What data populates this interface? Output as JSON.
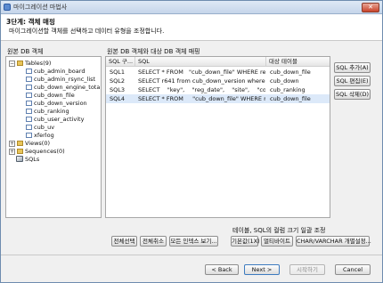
{
  "window": {
    "title": "마이그레이션 마법사",
    "close_glyph": "✕"
  },
  "header": {
    "step_title": "3단계: 객체 매핑",
    "step_desc": "마이그레이션할 객체를 선택하고 데이터 유형을 조정합니다."
  },
  "source": {
    "label": "원본 DB 객체",
    "tree": [
      {
        "label": "Tables(9)",
        "icon": "folder-icon",
        "expander": "−"
      },
      {
        "label": "cub_admin_board",
        "icon": "table-icon"
      },
      {
        "label": "cub_admin_rsync_list",
        "icon": "table-icon"
      },
      {
        "label": "cub_down_engine_total",
        "icon": "table-icon"
      },
      {
        "label": "cub_down_file",
        "icon": "table-icon"
      },
      {
        "label": "cub_down_version",
        "icon": "table-icon"
      },
      {
        "label": "cub_ranking",
        "icon": "table-icon"
      },
      {
        "label": "cub_user_activity",
        "icon": "table-icon"
      },
      {
        "label": "cub_uv",
        "icon": "table-icon"
      },
      {
        "label": "xferlog",
        "icon": "table-icon"
      },
      {
        "label": "Views(0)",
        "icon": "folder-icon",
        "expander": "+"
      },
      {
        "label": "Sequences(0)",
        "icon": "folder-icon",
        "expander": "+"
      },
      {
        "label": "SQLs",
        "icon": "sql-icon"
      }
    ]
  },
  "mapping": {
    "label": "원본 DB 객체와 대상 DB 객체 매핑",
    "columns": [
      "SQL 구...",
      "SQL",
      "대상 테이블"
    ],
    "rows": [
      {
        "name": "SQL1",
        "sql": "SELECT * FROM   \"cub_down_file\" WHERE reg_date...",
        "target": "cub_down_file",
        "selected": false
      },
      {
        "name": "SQL2",
        "sql": "SELECT r641 from cub_down_version where reg_d...",
        "target": "cub_down",
        "selected": false
      },
      {
        "name": "SQL3",
        "sql": "SELECT    \"key\",    \"reg_date\",    \"site\",    \"cou...",
        "target": "cub_ranking",
        "selected": false
      },
      {
        "name": "SQL4",
        "sql": "SELECT * FROM     \"cub_down_file\" WHERE reg_d...",
        "target": "cub_down_file",
        "selected": true
      }
    ]
  },
  "side_buttons": {
    "add": "SQL 추가(A)",
    "edit": "SQL 편집(E)",
    "delete": "SQL 삭제(D)"
  },
  "bottom": {
    "select_all": "전체선택",
    "deselect_all": "전체취소",
    "all_indexes": "모든 인덱스 보기...",
    "size_label": "테이블, SQL의 컬럼 크기 일괄 조정",
    "default_size": "기본값(1X)",
    "multibyte": "멀티바이트",
    "char_setting": "CHAR/VARCHAR 개별설정..."
  },
  "footer": {
    "back": "< Back",
    "next": "Next >",
    "start": "시작하기",
    "cancel": "Cancel"
  }
}
